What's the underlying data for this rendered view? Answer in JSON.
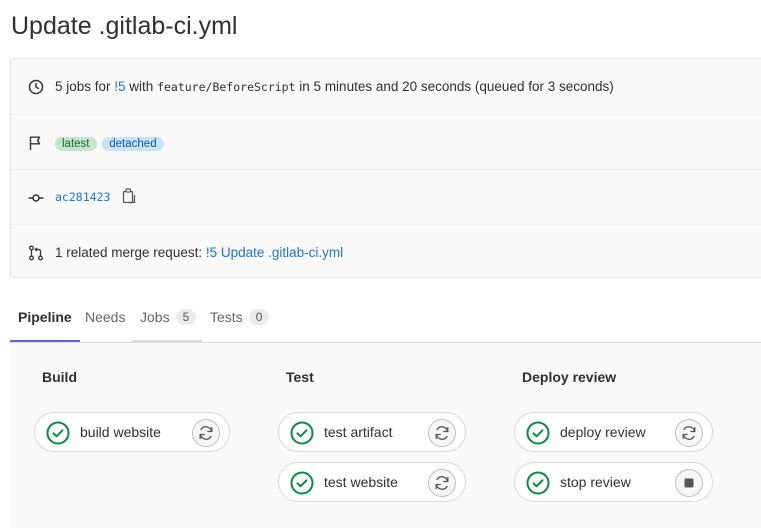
{
  "page": {
    "title": "Update .gitlab-ci.yml"
  },
  "summary": {
    "jobs_prefix": "5 jobs for ",
    "mr_link": "!5",
    "with_text": " with ",
    "branch": "feature/BeforeScript",
    "duration_text": " in 5 minutes and 20 seconds (queued for 3 seconds)",
    "badges": [
      "latest",
      "detached"
    ],
    "commit_sha": "ac281423",
    "merge_request_prefix": "1 related merge request: ",
    "merge_request_link": "!5 Update .gitlab-ci.yml"
  },
  "tabs": [
    {
      "label": "Pipeline"
    },
    {
      "label": "Needs"
    },
    {
      "label": "Jobs",
      "count": "5"
    },
    {
      "label": "Tests",
      "count": "0"
    }
  ],
  "stages": [
    {
      "title": "Build",
      "jobs": [
        {
          "name": "build website",
          "status": "passed",
          "action": "retry-icon"
        }
      ]
    },
    {
      "title": "Test",
      "jobs": [
        {
          "name": "test artifact",
          "status": "passed",
          "action": "retry-icon"
        },
        {
          "name": "test website",
          "status": "passed",
          "action": "retry-icon"
        }
      ]
    },
    {
      "title": "Deploy review",
      "jobs": [
        {
          "name": "deploy review",
          "status": "passed",
          "action": "retry-icon"
        },
        {
          "name": "stop review",
          "status": "passed",
          "action": "stop-icon"
        }
      ]
    }
  ],
  "colors": {
    "success": "#108548",
    "link": "#1f75cb",
    "tab_active": "#6666c4"
  }
}
